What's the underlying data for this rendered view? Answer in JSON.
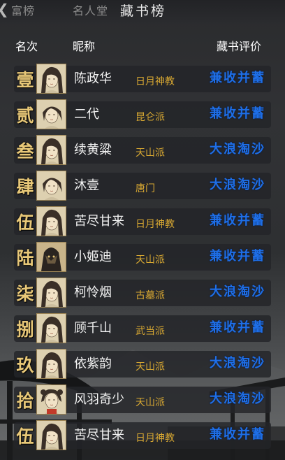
{
  "tabs": {
    "tab1_label": "富榜",
    "tab2_label": "名人堂",
    "tab3_label": "藏书榜",
    "active": "藏书榜"
  },
  "header": {
    "rank_label": "名次",
    "name_label": "昵称",
    "eval_label": "藏书评价"
  },
  "colors": {
    "rank": "#e8c878",
    "sect": "#d8a832",
    "eval": "#1e6fe8",
    "name": "#f2f2f2"
  },
  "rows": [
    {
      "rank": "壹",
      "name": "陈政华",
      "sect": "日月神教",
      "eval": "兼收并蓄",
      "avatar_icon": "portrait-female-icon"
    },
    {
      "rank": "贰",
      "name": "二代",
      "sect": "昆仑派",
      "eval": "兼收并蓄",
      "avatar_icon": "portrait-male-icon"
    },
    {
      "rank": "叁",
      "name": "续黄粱",
      "sect": "天山派",
      "eval": "大浪淘沙",
      "avatar_icon": "portrait-female-icon"
    },
    {
      "rank": "肆",
      "name": "沐壹",
      "sect": "唐门",
      "eval": "大浪淘沙",
      "avatar_icon": "portrait-male-icon"
    },
    {
      "rank": "伍",
      "name": "苦尽甘来",
      "sect": "日月神教",
      "eval": "兼收并蓄",
      "avatar_icon": "portrait-female-icon"
    },
    {
      "rank": "陆",
      "name": "小姬迪",
      "sect": "天山派",
      "eval": "兼收并蓄",
      "avatar_icon": "portrait-masked-icon"
    },
    {
      "rank": "柒",
      "name": "柯怜烟",
      "sect": "古墓派",
      "eval": "大浪淘沙",
      "avatar_icon": "portrait-female-icon"
    },
    {
      "rank": "捌",
      "name": "顾千山",
      "sect": "武当派",
      "eval": "兼收并蓄",
      "avatar_icon": "portrait-female-icon"
    },
    {
      "rank": "玖",
      "name": "依紫韵",
      "sect": "天山派",
      "eval": "大浪淘沙",
      "avatar_icon": "portrait-female-icon"
    },
    {
      "rank": "拾",
      "name": "风羽奇少",
      "sect": "天山派",
      "eval": "大浪淘沙",
      "avatar_icon": "portrait-girl-icon"
    },
    {
      "rank": "伍",
      "name": "苦尽甘来",
      "sect": "日月神教",
      "eval": "兼收并蓄",
      "avatar_icon": "portrait-female-icon"
    }
  ]
}
